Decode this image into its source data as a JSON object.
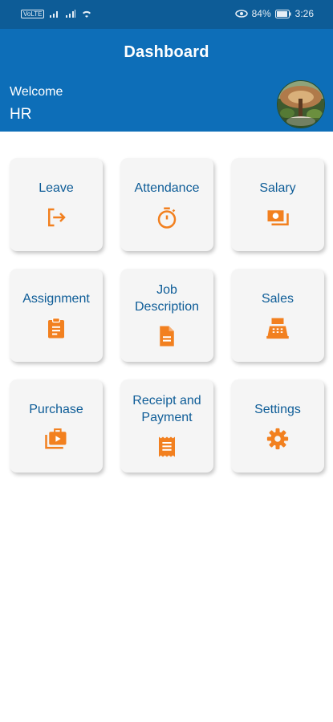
{
  "status_bar": {
    "time": "3:26",
    "battery": "84%",
    "carrier_badge": "VoLTE"
  },
  "header": {
    "title": "Dashboard",
    "welcome_label": "Welcome",
    "user_name": "HR"
  },
  "tiles": [
    {
      "label": "Leave",
      "icon": "exit-icon"
    },
    {
      "label": "Attendance",
      "icon": "stopwatch-icon"
    },
    {
      "label": "Salary",
      "icon": "money-icon"
    },
    {
      "label": "Assignment",
      "icon": "clipboard-icon"
    },
    {
      "label": "Job\nDescription",
      "icon": "document-icon"
    },
    {
      "label": "Sales",
      "icon": "cash-register-icon"
    },
    {
      "label": "Purchase",
      "icon": "briefcase-video-icon"
    },
    {
      "label": "Receipt and\nPayment",
      "icon": "receipt-icon"
    },
    {
      "label": "Settings",
      "icon": "gear-icon"
    }
  ],
  "colors": {
    "header_bg": "#0d6eb8",
    "status_bg": "#0d5c97",
    "tile_text": "#0d5c97",
    "icon_accent": "#f2801f",
    "tile_bg": "#f5f5f5"
  }
}
